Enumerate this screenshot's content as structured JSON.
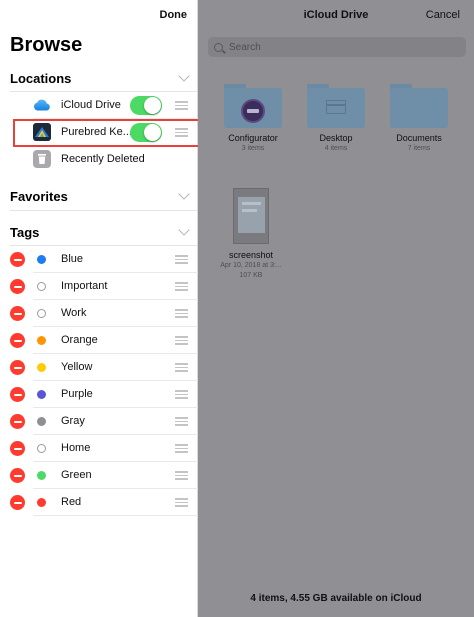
{
  "sidebar": {
    "done_label": "Done",
    "title": "Browse",
    "locations": {
      "header": "Locations",
      "items": [
        {
          "label": "iCloud Drive",
          "icon": "cloud-icon",
          "enabled": true
        },
        {
          "label": "Purebred Ke...",
          "icon": "app-icon",
          "enabled": true
        },
        {
          "label": "Recently Deleted",
          "icon": "trash-icon"
        }
      ]
    },
    "favorites": {
      "header": "Favorites"
    },
    "tags": {
      "header": "Tags",
      "items": [
        {
          "label": "Blue",
          "color": "#1e7cf2",
          "hollow": false
        },
        {
          "label": "Important",
          "color": "#ffffff",
          "hollow": true
        },
        {
          "label": "Work",
          "color": "#ffffff",
          "hollow": true
        },
        {
          "label": "Orange",
          "color": "#ff9500",
          "hollow": false
        },
        {
          "label": "Yellow",
          "color": "#ffcc00",
          "hollow": false
        },
        {
          "label": "Purple",
          "color": "#5856d6",
          "hollow": false
        },
        {
          "label": "Gray",
          "color": "#8e8e93",
          "hollow": false
        },
        {
          "label": "Home",
          "color": "#ffffff",
          "hollow": true
        },
        {
          "label": "Green",
          "color": "#4cd964",
          "hollow": false
        },
        {
          "label": "Red",
          "color": "#ff3b30",
          "hollow": false
        }
      ]
    }
  },
  "main": {
    "title": "iCloud Drive",
    "cancel_label": "Cancel",
    "search_placeholder": "Search",
    "folders": [
      {
        "name": "Configurator",
        "count": "3 items",
        "icon": "configurator-folder-icon"
      },
      {
        "name": "Desktop",
        "count": "4 items",
        "icon": "desktop-folder-icon"
      },
      {
        "name": "Documents",
        "count": "7 items",
        "icon": "documents-folder-icon"
      }
    ],
    "file": {
      "name": "screenshot",
      "date": "Apr 10, 2018 at 3:...",
      "size": "107 KB"
    },
    "footer": "4 items, 4.55 GB available on iCloud"
  },
  "colors": {
    "toggle_on": "#4cd964",
    "highlight": "#e8413a",
    "delete": "#ff3b30"
  }
}
